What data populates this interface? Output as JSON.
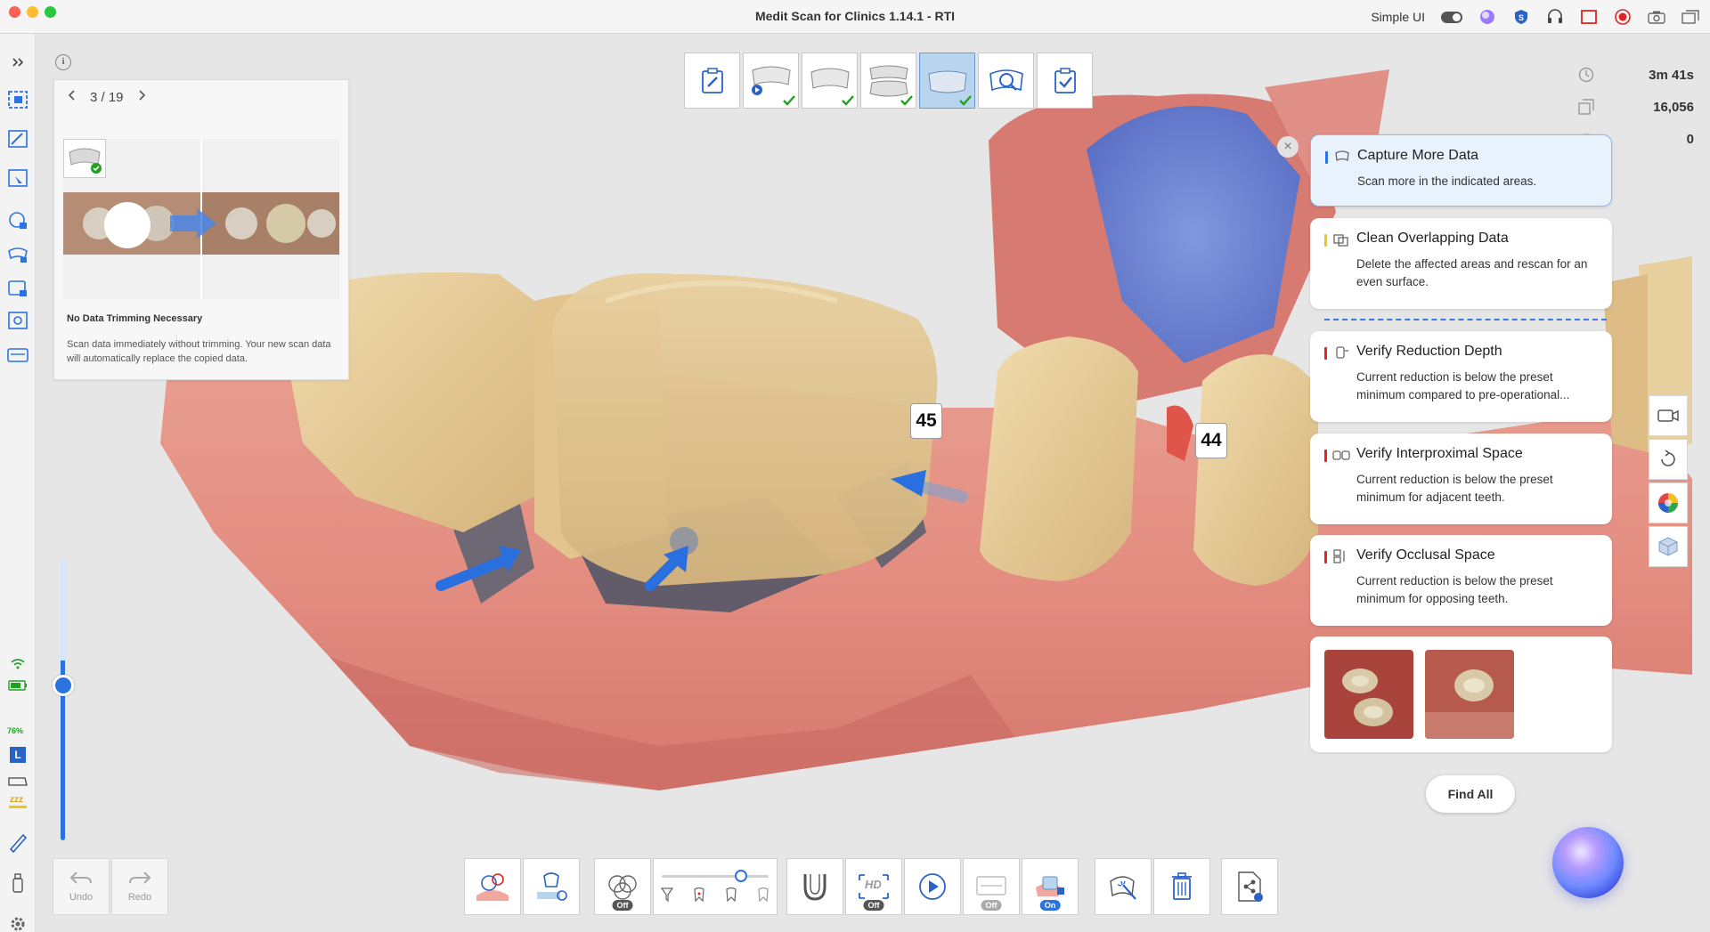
{
  "window": {
    "title": "Medit Scan for Clinics 1.14.1 - RTI",
    "simple_ui_label": "Simple UI"
  },
  "guide": {
    "page": "3 / 19",
    "title": "No Data Trimming Necessary",
    "description": "Scan data immediately without trimming. Your new scan data will automatically replace the copied data."
  },
  "stats": {
    "time": "3m 41s",
    "count": "16,056",
    "third": "0"
  },
  "tooth_labels": [
    "45",
    "44"
  ],
  "cards": [
    {
      "title": "Capture More Data",
      "desc": "Scan more in the indicated areas.",
      "color": "#2a73e0"
    },
    {
      "title": "Clean Overlapping Data",
      "desc": "Delete the affected areas and rescan for an even surface.",
      "color": "#f0c419"
    },
    {
      "title": "Verify Reduction Depth",
      "desc": "Current reduction is below the preset minimum compared to pre-operational...",
      "color": "#e02424"
    },
    {
      "title": "Verify Interproximal Space",
      "desc": "Current reduction is below the preset minimum for adjacent teeth.",
      "color": "#e02424"
    },
    {
      "title": "Verify Occlusal Space",
      "desc": "Current reduction is below the preset minimum for opposing teeth.",
      "color": "#e02424"
    }
  ],
  "find_all": "Find All",
  "undo_label": "Undo",
  "redo_label": "Redo",
  "battery_pct": "76%",
  "pills": {
    "off": "Off",
    "on": "On",
    "hd": "HD"
  },
  "sidebar_badge": "L"
}
